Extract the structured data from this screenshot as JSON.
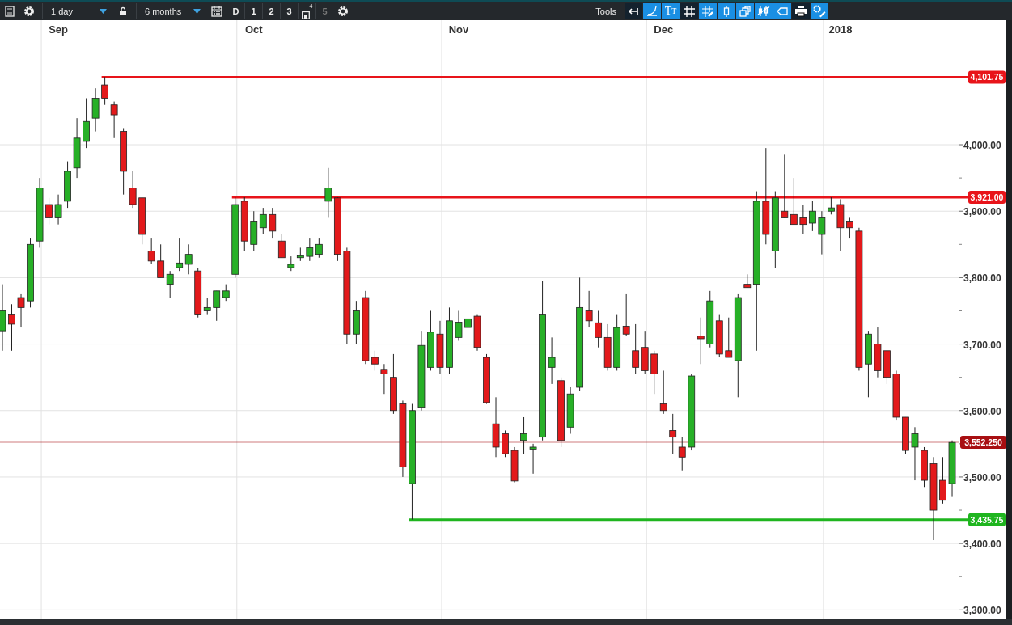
{
  "toolbar": {
    "left": [
      {
        "kind": "menu"
      },
      {
        "kind": "gear"
      },
      {
        "kind": "dropdown",
        "value": "1 day"
      },
      {
        "kind": "lock"
      },
      {
        "kind": "dropdown",
        "value": "6 months"
      },
      {
        "kind": "calendar"
      },
      {
        "kind": "preset",
        "label": "D",
        "disabled": false
      },
      {
        "kind": "preset",
        "label": "1",
        "disabled": false
      },
      {
        "kind": "preset",
        "label": "2",
        "disabled": false
      },
      {
        "kind": "preset",
        "label": "3",
        "disabled": false
      },
      {
        "kind": "save",
        "label": "4"
      },
      {
        "kind": "preset",
        "label": "5",
        "disabled": true
      },
      {
        "kind": "gear"
      }
    ],
    "tools_label": "Tools",
    "tools": [
      {
        "kind": "back",
        "selected": true
      },
      {
        "kind": "curve",
        "selected": false
      },
      {
        "kind": "text",
        "label": "TT",
        "selected": false
      },
      {
        "kind": "grid",
        "selected": true
      },
      {
        "kind": "grid-pencil",
        "selected": false
      },
      {
        "kind": "candle",
        "selected": false
      },
      {
        "kind": "windows",
        "selected": false
      },
      {
        "kind": "candles",
        "selected": false
      },
      {
        "kind": "tag",
        "selected": false
      },
      {
        "kind": "print",
        "selected": true
      },
      {
        "kind": "settings",
        "selected": false
      }
    ]
  },
  "chart": {
    "chart_data": {
      "type": "candlestick",
      "ylim": [
        3287,
        4157
      ],
      "grid": true,
      "categories": [
        null,
        null,
        null,
        null,
        null,
        null,
        "Sep",
        null,
        null,
        null,
        null,
        null,
        null,
        null,
        null,
        null,
        null,
        null,
        null,
        null,
        null,
        null,
        null,
        null,
        null,
        null,
        null,
        "Oct",
        null,
        null,
        null,
        null,
        null,
        null,
        null,
        null,
        null,
        null,
        null,
        null,
        null,
        null,
        null,
        null,
        null,
        null,
        null,
        null,
        null,
        "Nov",
        null,
        null,
        null,
        null,
        null,
        null,
        null,
        null,
        null,
        null,
        null,
        null,
        null,
        null,
        null,
        null,
        null,
        null,
        null,
        null,
        null,
        "Dec",
        null,
        null,
        null,
        null,
        null,
        null,
        null,
        null,
        null,
        null,
        null,
        null,
        null,
        null,
        null,
        null,
        null,
        null,
        "2018",
        null,
        null,
        null,
        null,
        null,
        null,
        null,
        null,
        null,
        null,
        null,
        null
      ],
      "yticks": [
        {
          "value": 3300,
          "label": "3,300.00"
        },
        {
          "value": 3400,
          "label": "3,400.00"
        },
        {
          "value": 3500,
          "label": "3,500.00"
        },
        {
          "value": 3600,
          "label": "3,600.00"
        },
        {
          "value": 3700,
          "label": "3,700.00"
        },
        {
          "value": 3800,
          "label": "3,800.00"
        },
        {
          "value": 3900,
          "label": "3,900.00"
        },
        {
          "value": 4000,
          "label": "4,000.00"
        }
      ],
      "ohlc": [
        [
          3720,
          3790,
          3690,
          3750
        ],
        [
          3745,
          3760,
          3690,
          3730
        ],
        [
          3770,
          3775,
          3725,
          3755
        ],
        [
          3765,
          3860,
          3755,
          3850
        ],
        [
          3855,
          3950,
          3845,
          3935
        ],
        [
          3910,
          3920,
          3880,
          3890
        ],
        [
          3890,
          3925,
          3880,
          3910
        ],
        [
          3915,
          3975,
          3905,
          3960
        ],
        [
          3965,
          4040,
          3950,
          4010
        ],
        [
          4005,
          4070,
          3995,
          4035
        ],
        [
          4040,
          4085,
          4020,
          4070
        ],
        [
          4090,
          4102,
          4060,
          4070
        ],
        [
          4060,
          4065,
          4010,
          4045
        ],
        [
          4020,
          4025,
          3925,
          3960
        ],
        [
          3935,
          3960,
          3905,
          3910
        ],
        [
          3920,
          3920,
          3850,
          3865
        ],
        [
          3840,
          3860,
          3820,
          3825
        ],
        [
          3825,
          3850,
          3800,
          3800
        ],
        [
          3790,
          3810,
          3770,
          3805
        ],
        [
          3815,
          3860,
          3810,
          3822
        ],
        [
          3820,
          3850,
          3805,
          3835
        ],
        [
          3810,
          3815,
          3740,
          3745
        ],
        [
          3750,
          3770,
          3745,
          3755
        ],
        [
          3755,
          3780,
          3735,
          3780
        ],
        [
          3770,
          3790,
          3765,
          3780
        ],
        [
          3805,
          3921,
          3800,
          3910
        ],
        [
          3915,
          3921,
          3840,
          3855
        ],
        [
          3850,
          3900,
          3840,
          3885
        ],
        [
          3875,
          3905,
          3865,
          3895
        ],
        [
          3895,
          3905,
          3860,
          3870
        ],
        [
          3855,
          3865,
          3830,
          3830
        ],
        [
          3815,
          3832,
          3810,
          3820
        ],
        [
          3830,
          3845,
          3825,
          3833
        ],
        [
          3832,
          3860,
          3825,
          3845
        ],
        [
          3835,
          3860,
          3830,
          3850
        ],
        [
          3915,
          3965,
          3890,
          3935
        ],
        [
          3920,
          3921,
          3825,
          3835
        ],
        [
          3840,
          3845,
          3700,
          3715
        ],
        [
          3715,
          3765,
          3700,
          3750
        ],
        [
          3770,
          3780,
          3670,
          3675
        ],
        [
          3680,
          3690,
          3660,
          3670
        ],
        [
          3662,
          3670,
          3625,
          3655
        ],
        [
          3650,
          3685,
          3595,
          3600
        ],
        [
          3610,
          3615,
          3500,
          3515
        ],
        [
          3490,
          3610,
          3436,
          3600
        ],
        [
          3605,
          3720,
          3600,
          3698
        ],
        [
          3665,
          3750,
          3660,
          3718
        ],
        [
          3715,
          3735,
          3655,
          3665
        ],
        [
          3665,
          3755,
          3655,
          3735
        ],
        [
          3710,
          3750,
          3705,
          3733
        ],
        [
          3725,
          3758,
          3720,
          3738
        ],
        [
          3742,
          3745,
          3690,
          3695
        ],
        [
          3680,
          3685,
          3610,
          3612
        ],
        [
          3580,
          3620,
          3530,
          3545
        ],
        [
          3565,
          3570,
          3530,
          3535
        ],
        [
          3540,
          3545,
          3492,
          3494
        ],
        [
          3555,
          3590,
          3535,
          3565
        ],
        [
          3542,
          3550,
          3505,
          3545
        ],
        [
          3560,
          3795,
          3555,
          3745
        ],
        [
          3665,
          3710,
          3640,
          3680
        ],
        [
          3645,
          3650,
          3545,
          3555
        ],
        [
          3575,
          3635,
          3565,
          3625
        ],
        [
          3635,
          3800,
          3630,
          3755
        ],
        [
          3750,
          3780,
          3725,
          3735
        ],
        [
          3732,
          3750,
          3695,
          3710
        ],
        [
          3710,
          3730,
          3660,
          3665
        ],
        [
          3665,
          3745,
          3660,
          3725
        ],
        [
          3727,
          3775,
          3712,
          3715
        ],
        [
          3690,
          3730,
          3655,
          3665
        ],
        [
          3695,
          3720,
          3655,
          3660
        ],
        [
          3685,
          3690,
          3625,
          3655
        ],
        [
          3610,
          3660,
          3595,
          3600
        ],
        [
          3570,
          3595,
          3535,
          3560
        ],
        [
          3545,
          3560,
          3510,
          3530
        ],
        [
          3545,
          3655,
          3540,
          3652
        ],
        [
          3712,
          3740,
          3670,
          3708
        ],
        [
          3700,
          3780,
          3695,
          3765
        ],
        [
          3735,
          3745,
          3680,
          3685
        ],
        [
          3690,
          3740,
          3680,
          3680
        ],
        [
          3675,
          3775,
          3620,
          3770
        ],
        [
          3790,
          3805,
          3785,
          3785
        ],
        [
          3790,
          3930,
          3690,
          3915
        ],
        [
          3915,
          3995,
          3850,
          3865
        ],
        [
          3840,
          3930,
          3815,
          3920
        ],
        [
          3900,
          3985,
          3890,
          3890
        ],
        [
          3895,
          3950,
          3880,
          3880
        ],
        [
          3890,
          3910,
          3865,
          3880
        ],
        [
          3882,
          3915,
          3870,
          3900
        ],
        [
          3865,
          3900,
          3835,
          3890
        ],
        [
          3900,
          3921,
          3895,
          3905
        ],
        [
          3910,
          3918,
          3840,
          3875
        ],
        [
          3885,
          3890,
          3860,
          3875
        ],
        [
          3870,
          3875,
          3660,
          3665
        ],
        [
          3670,
          3720,
          3620,
          3715
        ],
        [
          3700,
          3725,
          3650,
          3660
        ],
        [
          3690,
          3690,
          3640,
          3650
        ],
        [
          3655,
          3660,
          3585,
          3590
        ],
        [
          3590,
          3590,
          3535,
          3540
        ],
        [
          3545,
          3575,
          3495,
          3565
        ],
        [
          3540,
          3545,
          3485,
          3495
        ],
        [
          3520,
          3530,
          3405,
          3450
        ],
        [
          3495,
          3530,
          3460,
          3465
        ],
        [
          3490,
          3555,
          3470,
          3552
        ]
      ],
      "ref_lines": [
        {
          "axis": "y",
          "value": 4101.75,
          "label": "4,101.75",
          "color": "#e8141a"
        },
        {
          "axis": "y",
          "value": 3921,
          "label": "3,921.00",
          "color": "#e8141a"
        },
        {
          "axis": "y",
          "value": 3552.25,
          "label": "3,552.250",
          "color": "#a80f12"
        },
        {
          "axis": "y",
          "value": 3435.75,
          "label": "3,435.75",
          "color": "#1fb51f"
        }
      ]
    }
  }
}
